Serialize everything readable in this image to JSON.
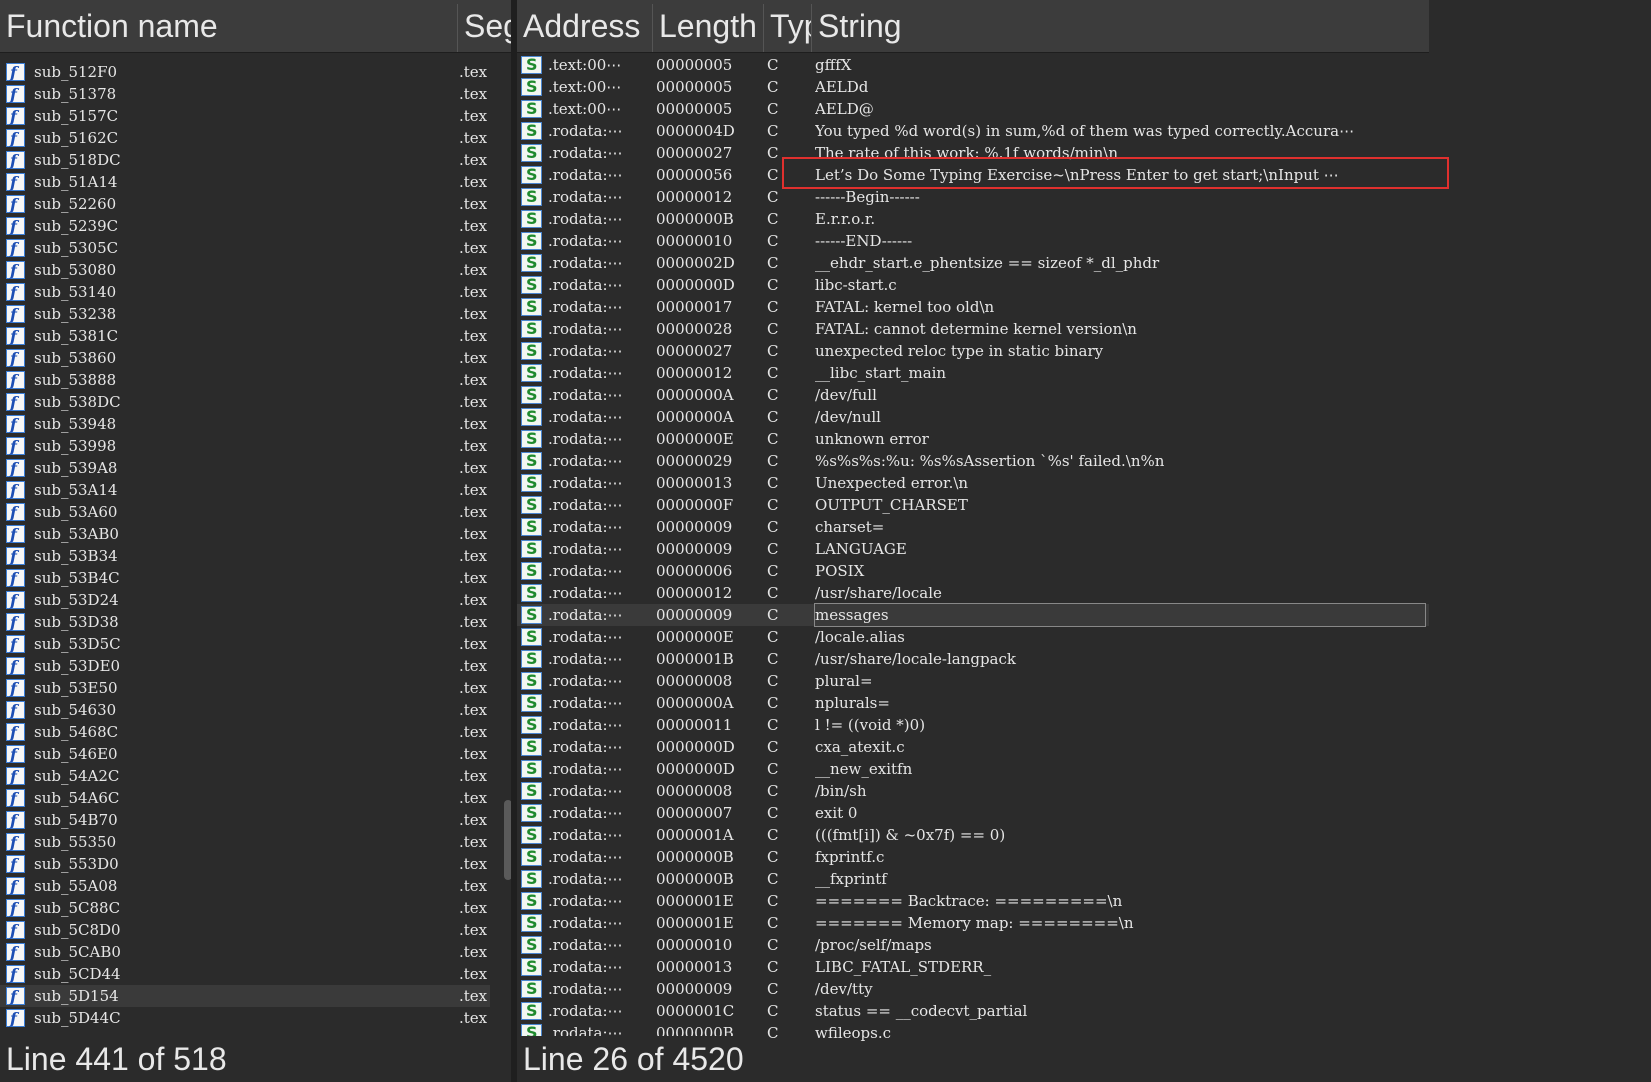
{
  "functions_panel": {
    "columns": [
      "Function name",
      "Seg"
    ],
    "rows": [
      {
        "name": "sub_512F0",
        "seg": ".tex"
      },
      {
        "name": "sub_51378",
        "seg": ".tex"
      },
      {
        "name": "sub_5157C",
        "seg": ".tex"
      },
      {
        "name": "sub_5162C",
        "seg": ".tex"
      },
      {
        "name": "sub_518DC",
        "seg": ".tex"
      },
      {
        "name": "sub_51A14",
        "seg": ".tex"
      },
      {
        "name": "sub_52260",
        "seg": ".tex"
      },
      {
        "name": "sub_5239C",
        "seg": ".tex"
      },
      {
        "name": "sub_5305C",
        "seg": ".tex"
      },
      {
        "name": "sub_53080",
        "seg": ".tex"
      },
      {
        "name": "sub_53140",
        "seg": ".tex"
      },
      {
        "name": "sub_53238",
        "seg": ".tex"
      },
      {
        "name": "sub_5381C",
        "seg": ".tex"
      },
      {
        "name": "sub_53860",
        "seg": ".tex"
      },
      {
        "name": "sub_53888",
        "seg": ".tex"
      },
      {
        "name": "sub_538DC",
        "seg": ".tex"
      },
      {
        "name": "sub_53948",
        "seg": ".tex"
      },
      {
        "name": "sub_53998",
        "seg": ".tex"
      },
      {
        "name": "sub_539A8",
        "seg": ".tex"
      },
      {
        "name": "sub_53A14",
        "seg": ".tex"
      },
      {
        "name": "sub_53A60",
        "seg": ".tex"
      },
      {
        "name": "sub_53AB0",
        "seg": ".tex"
      },
      {
        "name": "sub_53B34",
        "seg": ".tex"
      },
      {
        "name": "sub_53B4C",
        "seg": ".tex"
      },
      {
        "name": "sub_53D24",
        "seg": ".tex"
      },
      {
        "name": "sub_53D38",
        "seg": ".tex"
      },
      {
        "name": "sub_53D5C",
        "seg": ".tex"
      },
      {
        "name": "sub_53DE0",
        "seg": ".tex"
      },
      {
        "name": "sub_53E50",
        "seg": ".tex"
      },
      {
        "name": "sub_54630",
        "seg": ".tex"
      },
      {
        "name": "sub_5468C",
        "seg": ".tex"
      },
      {
        "name": "sub_546E0",
        "seg": ".tex"
      },
      {
        "name": "sub_54A2C",
        "seg": ".tex"
      },
      {
        "name": "sub_54A6C",
        "seg": ".tex"
      },
      {
        "name": "sub_54B70",
        "seg": ".tex"
      },
      {
        "name": "sub_55350",
        "seg": ".tex"
      },
      {
        "name": "sub_553D0",
        "seg": ".tex"
      },
      {
        "name": "sub_55A08",
        "seg": ".tex"
      },
      {
        "name": "sub_5C88C",
        "seg": ".tex"
      },
      {
        "name": "sub_5C8D0",
        "seg": ".tex"
      },
      {
        "name": "sub_5CAB0",
        "seg": ".tex"
      },
      {
        "name": "sub_5CD44",
        "seg": ".tex"
      },
      {
        "name": "sub_5D154",
        "seg": ".tex",
        "selected": true
      },
      {
        "name": "sub_5D44C",
        "seg": ".tex"
      }
    ],
    "status": "Line 441 of 518"
  },
  "strings_panel": {
    "columns": [
      "Address",
      "Length",
      "Typ",
      "String"
    ],
    "rows": [
      {
        "address": ".text:00⋯",
        "length": "00000005",
        "type": "C",
        "string": "gfffX"
      },
      {
        "address": ".text:00⋯",
        "length": "00000005",
        "type": "C",
        "string": "AELDd"
      },
      {
        "address": ".text:00⋯",
        "length": "00000005",
        "type": "C",
        "string": "AELD@"
      },
      {
        "address": ".rodata:⋯",
        "length": "0000004D",
        "type": "C",
        "string": "You typed %d word(s) in sum,%d of them was typed correctly.Accura⋯"
      },
      {
        "address": ".rodata:⋯",
        "length": "00000027",
        "type": "C",
        "string": "The rate of this work: %.1f words/min\\n"
      },
      {
        "address": ".rodata:⋯",
        "length": "00000056",
        "type": "C",
        "string": "Let’s Do Some Typing Exercise~\\nPress Enter to get start;\\nInput ⋯",
        "highlighted": true
      },
      {
        "address": ".rodata:⋯",
        "length": "00000012",
        "type": "C",
        "string": "------Begin------"
      },
      {
        "address": ".rodata:⋯",
        "length": "0000000B",
        "type": "C",
        "string": "E.r.r.o.r."
      },
      {
        "address": ".rodata:⋯",
        "length": "00000010",
        "type": "C",
        "string": "------END------"
      },
      {
        "address": ".rodata:⋯",
        "length": "0000002D",
        "type": "C",
        "string": "__ehdr_start.e_phentsize == sizeof *_dl_phdr"
      },
      {
        "address": ".rodata:⋯",
        "length": "0000000D",
        "type": "C",
        "string": "libc-start.c"
      },
      {
        "address": ".rodata:⋯",
        "length": "00000017",
        "type": "C",
        "string": "FATAL: kernel too old\\n"
      },
      {
        "address": ".rodata:⋯",
        "length": "00000028",
        "type": "C",
        "string": "FATAL: cannot determine kernel version\\n"
      },
      {
        "address": ".rodata:⋯",
        "length": "00000027",
        "type": "C",
        "string": "unexpected reloc type in static binary"
      },
      {
        "address": ".rodata:⋯",
        "length": "00000012",
        "type": "C",
        "string": "__libc_start_main"
      },
      {
        "address": ".rodata:⋯",
        "length": "0000000A",
        "type": "C",
        "string": "/dev/full"
      },
      {
        "address": ".rodata:⋯",
        "length": "0000000A",
        "type": "C",
        "string": "/dev/null"
      },
      {
        "address": ".rodata:⋯",
        "length": "0000000E",
        "type": "C",
        "string": "unknown error"
      },
      {
        "address": ".rodata:⋯",
        "length": "00000029",
        "type": "C",
        "string": "%s%s%s:%u: %s%sAssertion `%s' failed.\\n%n"
      },
      {
        "address": ".rodata:⋯",
        "length": "00000013",
        "type": "C",
        "string": "Unexpected error.\\n"
      },
      {
        "address": ".rodata:⋯",
        "length": "0000000F",
        "type": "C",
        "string": "OUTPUT_CHARSET"
      },
      {
        "address": ".rodata:⋯",
        "length": "00000009",
        "type": "C",
        "string": "charset="
      },
      {
        "address": ".rodata:⋯",
        "length": "00000009",
        "type": "C",
        "string": "LANGUAGE"
      },
      {
        "address": ".rodata:⋯",
        "length": "00000006",
        "type": "C",
        "string": "POSIX"
      },
      {
        "address": ".rodata:⋯",
        "length": "00000012",
        "type": "C",
        "string": "/usr/share/locale"
      },
      {
        "address": ".rodata:⋯",
        "length": "00000009",
        "type": "C",
        "string": "messages",
        "selected": true
      },
      {
        "address": ".rodata:⋯",
        "length": "0000000E",
        "type": "C",
        "string": "/locale.alias"
      },
      {
        "address": ".rodata:⋯",
        "length": "0000001B",
        "type": "C",
        "string": "/usr/share/locale-langpack"
      },
      {
        "address": ".rodata:⋯",
        "length": "00000008",
        "type": "C",
        "string": "plural="
      },
      {
        "address": ".rodata:⋯",
        "length": "0000000A",
        "type": "C",
        "string": "nplurals="
      },
      {
        "address": ".rodata:⋯",
        "length": "00000011",
        "type": "C",
        "string": "l != ((void *)0)"
      },
      {
        "address": ".rodata:⋯",
        "length": "0000000D",
        "type": "C",
        "string": "cxa_atexit.c"
      },
      {
        "address": ".rodata:⋯",
        "length": "0000000D",
        "type": "C",
        "string": "__new_exitfn"
      },
      {
        "address": ".rodata:⋯",
        "length": "00000008",
        "type": "C",
        "string": "/bin/sh"
      },
      {
        "address": ".rodata:⋯",
        "length": "00000007",
        "type": "C",
        "string": "exit 0"
      },
      {
        "address": ".rodata:⋯",
        "length": "0000001A",
        "type": "C",
        "string": "(((fmt[i]) & ~0x7f) == 0)"
      },
      {
        "address": ".rodata:⋯",
        "length": "0000000B",
        "type": "C",
        "string": "fxprintf.c"
      },
      {
        "address": ".rodata:⋯",
        "length": "0000000B",
        "type": "C",
        "string": "__fxprintf"
      },
      {
        "address": ".rodata:⋯",
        "length": "0000001E",
        "type": "C",
        "string": "======= Backtrace: =========\\n"
      },
      {
        "address": ".rodata:⋯",
        "length": "0000001E",
        "type": "C",
        "string": "======= Memory map: ========\\n"
      },
      {
        "address": ".rodata:⋯",
        "length": "00000010",
        "type": "C",
        "string": "/proc/self/maps"
      },
      {
        "address": ".rodata:⋯",
        "length": "00000013",
        "type": "C",
        "string": "LIBC_FATAL_STDERR_"
      },
      {
        "address": ".rodata:⋯",
        "length": "00000009",
        "type": "C",
        "string": "/dev/tty"
      },
      {
        "address": ".rodata:⋯",
        "length": "0000001C",
        "type": "C",
        "string": "status == __codecvt_partial"
      },
      {
        "address": ".rodata:⋯",
        "length": "0000000B",
        "type": "C",
        "string": "wfileops.c"
      }
    ],
    "status": "Line 26 of 4520"
  },
  "icons": {
    "function": "function-icon",
    "string": "string-icon",
    "function_glyph": "f",
    "string_glyph": "S"
  },
  "colors": {
    "background": "#2b2b2b",
    "header": "#3c3c3c",
    "highlight_box": "#e0302e",
    "text": "#e6e6e6"
  }
}
